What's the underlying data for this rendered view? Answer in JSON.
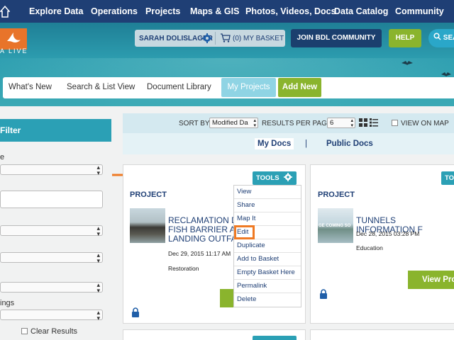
{
  "top_nav": {
    "items": [
      "Explore Data",
      "Operations",
      "Projects",
      "Maps & GIS",
      "Photos, Videos, Docs",
      "Data Catalog",
      "Community"
    ]
  },
  "header": {
    "logo_text": "A LIVE",
    "user_name": "SARAH DOLISLAGER",
    "basket_label": "(0) MY BASKET",
    "join_label": "JOIN BDL COMMUNITY",
    "help_label": "HELP",
    "search_label": "SEAR"
  },
  "tabs": {
    "whats_new": "What's New",
    "search_list": "Search & List View",
    "doc_library": "Document Library",
    "my_projects": "My Projects",
    "add_new": "Add New"
  },
  "filter": {
    "title": "Filter",
    "labels": [
      "e",
      "ings"
    ],
    "clear_label": "Clear Results"
  },
  "toolbar": {
    "sort_label": "SORT BY",
    "sort_value": "Modified Da",
    "results_label": "RESULTS PER PAGE",
    "results_value": "6",
    "view_on_map": "VIEW ON MAP"
  },
  "doc_tabs": {
    "my_docs": "My Docs",
    "divider": "|",
    "public_docs": "Public Docs"
  },
  "cards": [
    {
      "type": "PROJECT",
      "tools_label": "TOOLS",
      "title_lines": [
        "RECLAMATION D",
        "FISH BARRIER AT",
        "LANDING OUTFA"
      ],
      "date": "Dec 29, 2015 11:17 AM",
      "category": "Restoration"
    },
    {
      "type": "PROJECT",
      "tools_label": "TO",
      "title": "TUNNELS INFORMATION F",
      "date": "Dec 28, 2015 03:28 PM",
      "category": "Education",
      "thumb_text": "GE COMING SO",
      "view_label": "View Pro"
    }
  ],
  "tools_menu": {
    "items": [
      "View",
      "Share",
      "Map It",
      "Edit",
      "Duplicate",
      "Add to Basket",
      "Empty Basket Here",
      "Permalink",
      "Delete"
    ]
  },
  "colors": {
    "nav_bg": "#1f3f75",
    "teal": "#2ba0b5",
    "green": "#8ab42d",
    "orange_highlight": "#ef7a24"
  }
}
